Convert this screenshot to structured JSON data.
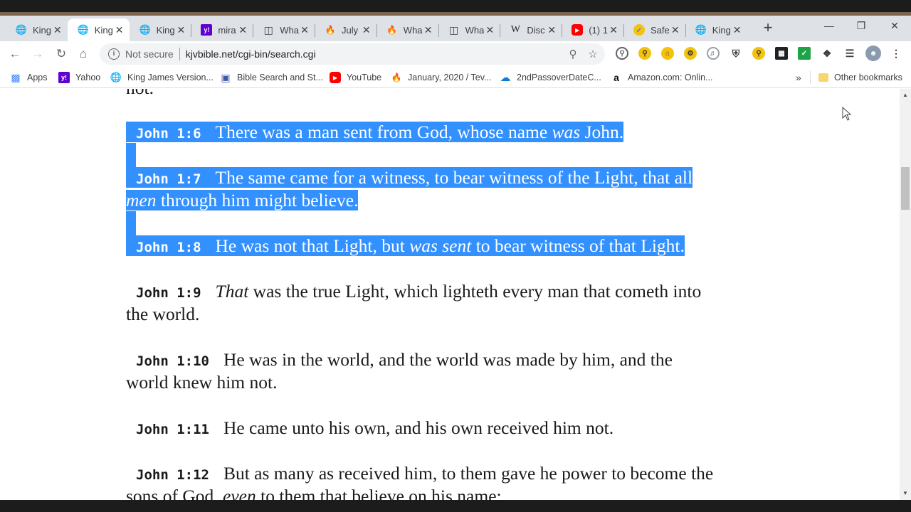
{
  "browser": {
    "tabs": [
      {
        "label": "King",
        "icon": "globe-icon"
      },
      {
        "label": "King",
        "icon": "globe-icon"
      },
      {
        "label": "King",
        "icon": "globe-icon"
      },
      {
        "label": "mira",
        "icon": "yahoo-icon"
      },
      {
        "label": "Wha",
        "icon": "book-icon"
      },
      {
        "label": "July",
        "icon": "flame-icon"
      },
      {
        "label": "Wha",
        "icon": "flame-icon"
      },
      {
        "label": "Wha",
        "icon": "book-icon"
      },
      {
        "label": "Disc",
        "icon": "wikipedia-icon"
      },
      {
        "label": "(1) 1",
        "icon": "youtube-icon"
      },
      {
        "label": "Safe",
        "icon": "checkmark-icon"
      },
      {
        "label": "King",
        "icon": "globe-icon"
      }
    ],
    "active_tab_index": 1,
    "address": {
      "security_label": "Not secure",
      "url": "kjvbible.net/cgi-bin/search.cgi"
    },
    "bookmarks": [
      {
        "label": "Apps",
        "icon": "apps-grid-icon"
      },
      {
        "label": "Yahoo",
        "icon": "yahoo-icon"
      },
      {
        "label": "King James Version...",
        "icon": "globe-icon"
      },
      {
        "label": "Bible Search and St...",
        "icon": "bible-icon"
      },
      {
        "label": "YouTube",
        "icon": "youtube-icon"
      },
      {
        "label": "January, 2020 / Tev...",
        "icon": "flame-icon"
      },
      {
        "label": "2ndPassoverDateC...",
        "icon": "onedrive-icon"
      },
      {
        "label": "Amazon.com: Onlin...",
        "icon": "amazon-icon"
      }
    ],
    "bookmarks_overflow": "»",
    "other_bookmarks": "Other bookmarks"
  },
  "page": {
    "top_partial": "not.",
    "verses": [
      {
        "ref": "John 1:6",
        "lines": [
          [
            "There was a man sent from God, whose name ",
            "was",
            " John."
          ]
        ],
        "selected": true
      },
      {
        "ref": "John 1:7",
        "lines": [
          [
            "The same came for a witness, to bear witness of the Light, that all",
            "",
            ""
          ],
          [
            "",
            "men",
            " through him might believe."
          ]
        ],
        "selected": true
      },
      {
        "ref": "John 1:8",
        "lines": [
          [
            "He was not that Light, but ",
            "was sent",
            " to bear witness of that Light."
          ]
        ],
        "selected": true
      },
      {
        "ref": "John 1:9",
        "lines": [
          [
            "",
            "That",
            " was the true Light, which lighteth every man that cometh into"
          ],
          [
            "the world.",
            "",
            ""
          ]
        ],
        "selected": false
      },
      {
        "ref": "John 1:10",
        "lines": [
          [
            "He was in the world, and the world was made by him, and the",
            "",
            ""
          ],
          [
            "world knew him not.",
            "",
            ""
          ]
        ],
        "selected": false
      },
      {
        "ref": "John 1:11",
        "lines": [
          [
            "He came unto his own, and his own received him not.",
            "",
            ""
          ]
        ],
        "selected": false
      },
      {
        "ref": "John 1:12",
        "lines": [
          [
            "But as many as received him, to them gave he power to become the",
            "",
            ""
          ],
          [
            "sons of God, ",
            "even",
            " to them that believe on his name:"
          ]
        ],
        "selected": false
      }
    ]
  },
  "colors": {
    "selection": "#3390ff",
    "tabstrip": "#dee1e6"
  }
}
